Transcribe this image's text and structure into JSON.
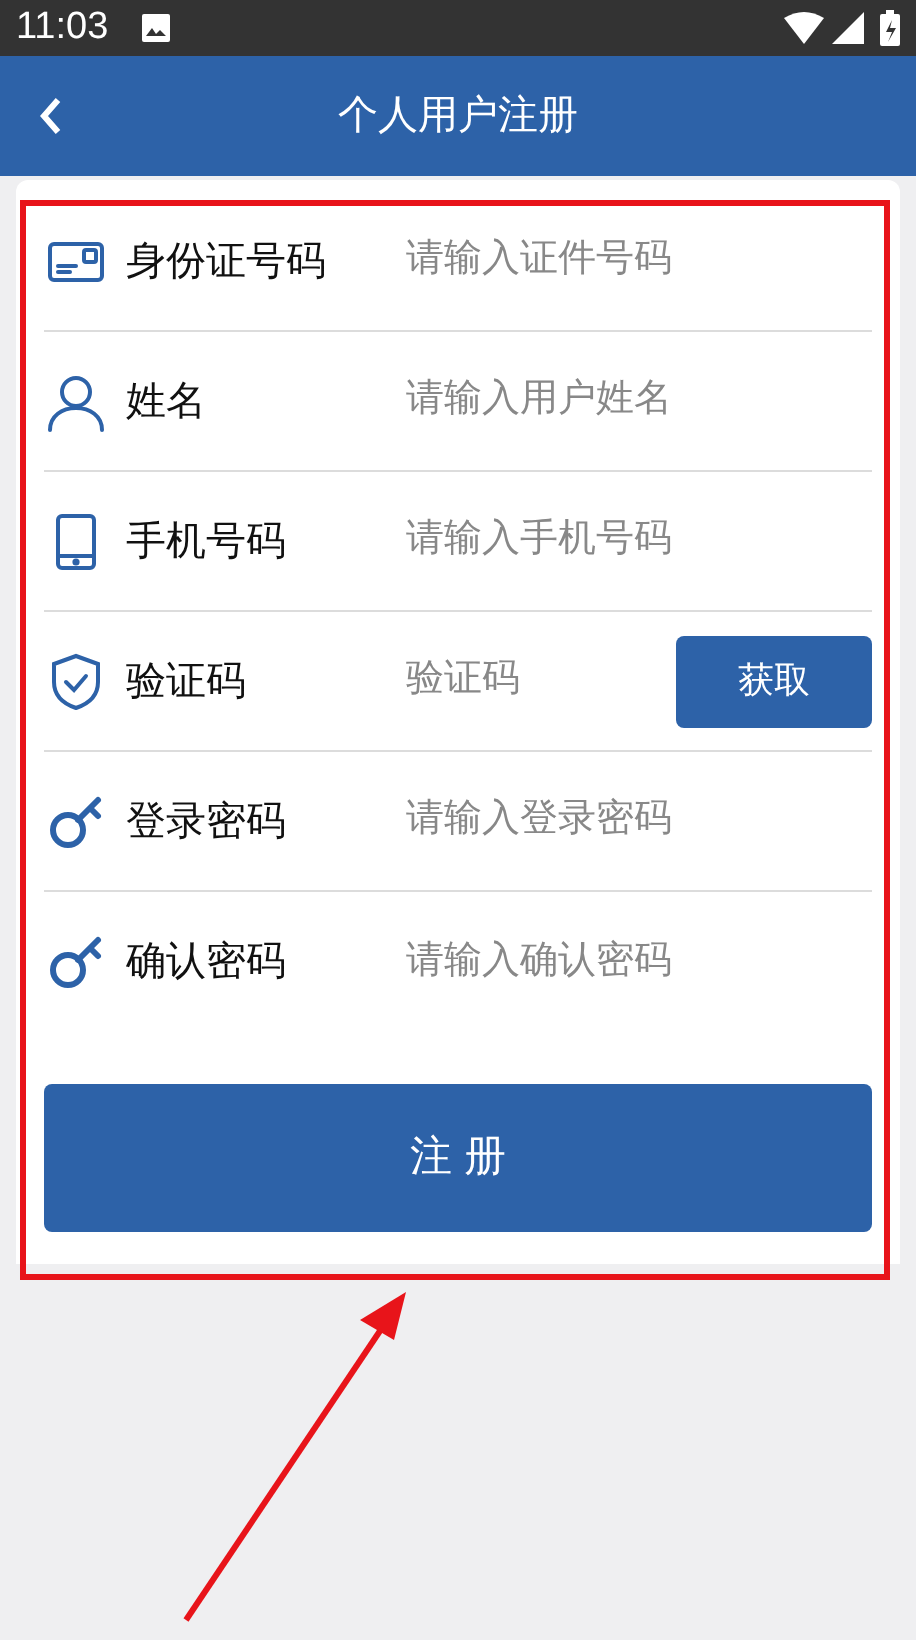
{
  "status_bar": {
    "time": "11:03"
  },
  "header": {
    "title": "个人用户注册"
  },
  "fields": [
    {
      "kind": "text",
      "label": "身份证号码",
      "placeholder": "请输入证件号码"
    },
    {
      "kind": "text",
      "label": "姓名",
      "placeholder": "请输入用户姓名"
    },
    {
      "kind": "text",
      "label": "手机号码",
      "placeholder": "请输入手机号码"
    },
    {
      "kind": "code",
      "label": "验证码",
      "placeholder": "验证码",
      "button": "获取"
    },
    {
      "kind": "password",
      "label": "登录密码",
      "placeholder": "请输入登录密码"
    },
    {
      "kind": "password",
      "label": "确认密码",
      "placeholder": "请输入确认密码"
    }
  ],
  "submit_button": "注 册"
}
